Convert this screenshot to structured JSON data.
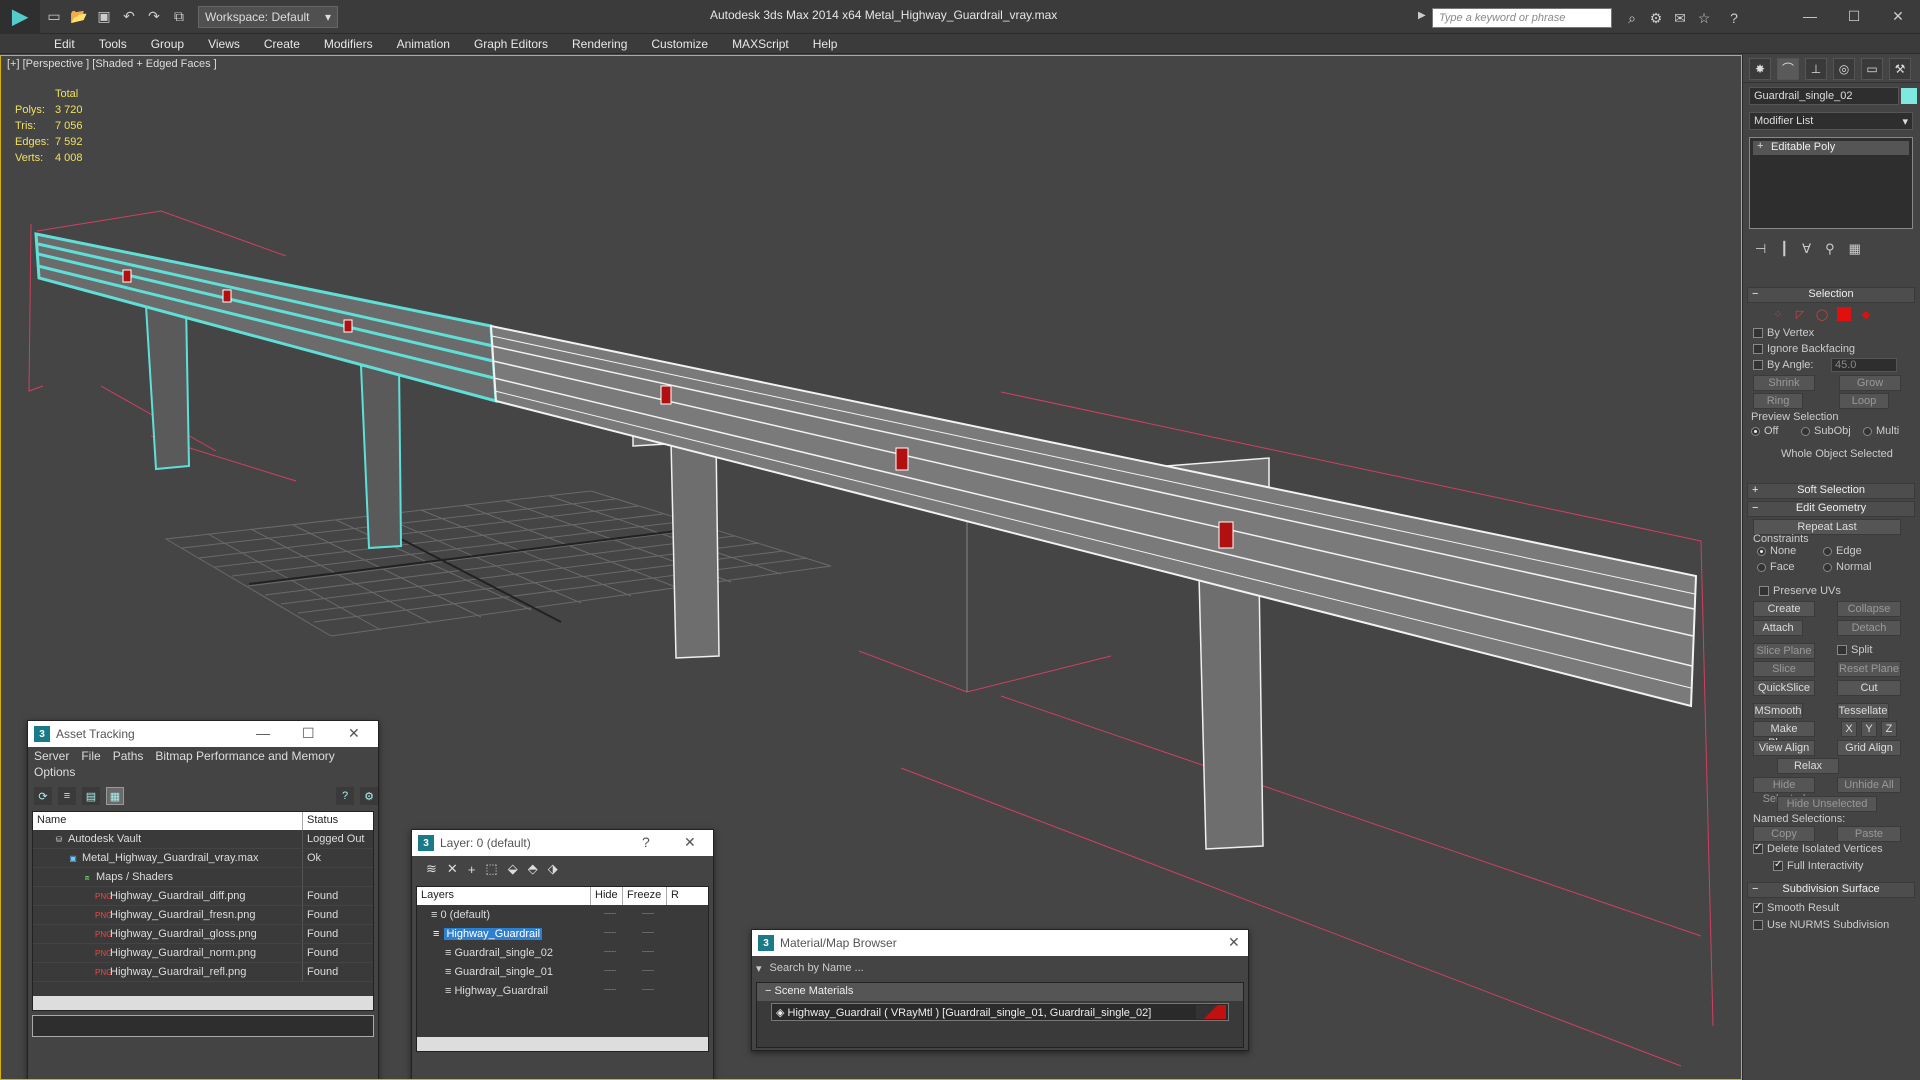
{
  "titlebar": {
    "app_title": "Autodesk 3ds Max  2014 x64      Metal_Highway_Guardrail_vray.max",
    "workspace": "Workspace: Default",
    "search_placeholder": "Type a keyword or phrase"
  },
  "menu": [
    "Edit",
    "Tools",
    "Group",
    "Views",
    "Create",
    "Modifiers",
    "Animation",
    "Graph Editors",
    "Rendering",
    "Customize",
    "MAXScript",
    "Help"
  ],
  "viewport": {
    "label": "[+] [Perspective ] [Shaded + Edged Faces ]",
    "stats_header": "Total",
    "stats": [
      {
        "key": "Polys:",
        "value": "3 720"
      },
      {
        "key": "Tris:",
        "value": "7 056"
      },
      {
        "key": "Edges:",
        "value": "7 592"
      },
      {
        "key": "Verts:",
        "value": "4 008"
      }
    ]
  },
  "command_panel": {
    "object_name": "Guardrail_single_02",
    "object_color": "#7fe8e0",
    "modifier_list": "Modifier List",
    "stack_item": "Editable Poly",
    "selection": {
      "title": "Selection",
      "by_vertex": "By Vertex",
      "ignore_backfacing": "Ignore Backfacing",
      "by_angle": "By Angle:",
      "angle_value": "45.0",
      "shrink": "Shrink",
      "grow": "Grow",
      "ring": "Ring",
      "loop": "Loop",
      "preview_selection": "Preview Selection",
      "off": "Off",
      "subobj": "SubObj",
      "multi": "Multi",
      "status": "Whole Object Selected"
    },
    "soft_selection": "Soft Selection",
    "edit_geometry": {
      "title": "Edit Geometry",
      "repeat_last": "Repeat Last",
      "constraints": "Constraints",
      "none": "None",
      "edge": "Edge",
      "face": "Face",
      "normal": "Normal",
      "preserve_uvs": "Preserve UVs",
      "create": "Create",
      "collapse": "Collapse",
      "attach": "Attach",
      "detach": "Detach",
      "slice_plane": "Slice Plane",
      "split": "Split",
      "slice": "Slice",
      "reset_plane": "Reset Plane",
      "quickslice": "QuickSlice",
      "cut": "Cut",
      "msmooth": "MSmooth",
      "tessellate": "Tessellate",
      "make_planar": "Make Planar",
      "x": "X",
      "y": "Y",
      "z": "Z",
      "view_align": "View Align",
      "grid_align": "Grid Align",
      "relax": "Relax",
      "hide_selected": "Hide Selected",
      "unhide_all": "Unhide All",
      "hide_unselected": "Hide Unselected",
      "named_selections": "Named Selections:",
      "copy": "Copy",
      "paste": "Paste",
      "delete_isolated": "Delete Isolated Vertices",
      "full_interactivity": "Full Interactivity"
    },
    "subdivision": {
      "title": "Subdivision Surface",
      "smooth_result": "Smooth Result",
      "use_nurms": "Use NURMS Subdivision"
    }
  },
  "asset_tracking": {
    "title": "Asset Tracking",
    "menu": [
      "Server",
      "File",
      "Paths",
      "Bitmap Performance and Memory"
    ],
    "menu2": "Options",
    "columns": [
      "Name",
      "Status"
    ],
    "rows": [
      {
        "name": "Autodesk Vault",
        "status": "Logged Out",
        "indent": 20,
        "icon": "vault"
      },
      {
        "name": "Metal_Highway_Guardrail_vray.max",
        "status": "Ok",
        "indent": 34,
        "icon": "max"
      },
      {
        "name": "Maps / Shaders",
        "status": "",
        "indent": 48,
        "icon": "maps"
      },
      {
        "name": "Highway_Guardrail_diff.png",
        "status": "Found",
        "indent": 62,
        "icon": "png"
      },
      {
        "name": "Highway_Guardrail_fresn.png",
        "status": "Found",
        "indent": 62,
        "icon": "png"
      },
      {
        "name": "Highway_Guardrail_gloss.png",
        "status": "Found",
        "indent": 62,
        "icon": "png"
      },
      {
        "name": "Highway_Guardrail_norm.png",
        "status": "Found",
        "indent": 62,
        "icon": "png"
      },
      {
        "name": "Highway_Guardrail_refl.png",
        "status": "Found",
        "indent": 62,
        "icon": "png"
      }
    ]
  },
  "layer_window": {
    "title": "Layer: 0 (default)",
    "columns": [
      "Layers",
      "Hide",
      "Freeze",
      "R"
    ],
    "rows": [
      {
        "name": "0 (default)",
        "indent": 14,
        "selected": false
      },
      {
        "name": "Highway_Guardrail",
        "indent": 14,
        "selected": true
      },
      {
        "name": "Guardrail_single_02",
        "indent": 28,
        "selected": false
      },
      {
        "name": "Guardrail_single_01",
        "indent": 28,
        "selected": false
      },
      {
        "name": "Highway_Guardrail",
        "indent": 28,
        "selected": false
      }
    ]
  },
  "material_browser": {
    "title": "Material/Map Browser",
    "search_placeholder": "Search by Name ...",
    "group": "Scene Materials",
    "entry": "Highway_Guardrail  ( VRayMtl ) [Guardrail_single_01, Guardrail_single_02]"
  }
}
